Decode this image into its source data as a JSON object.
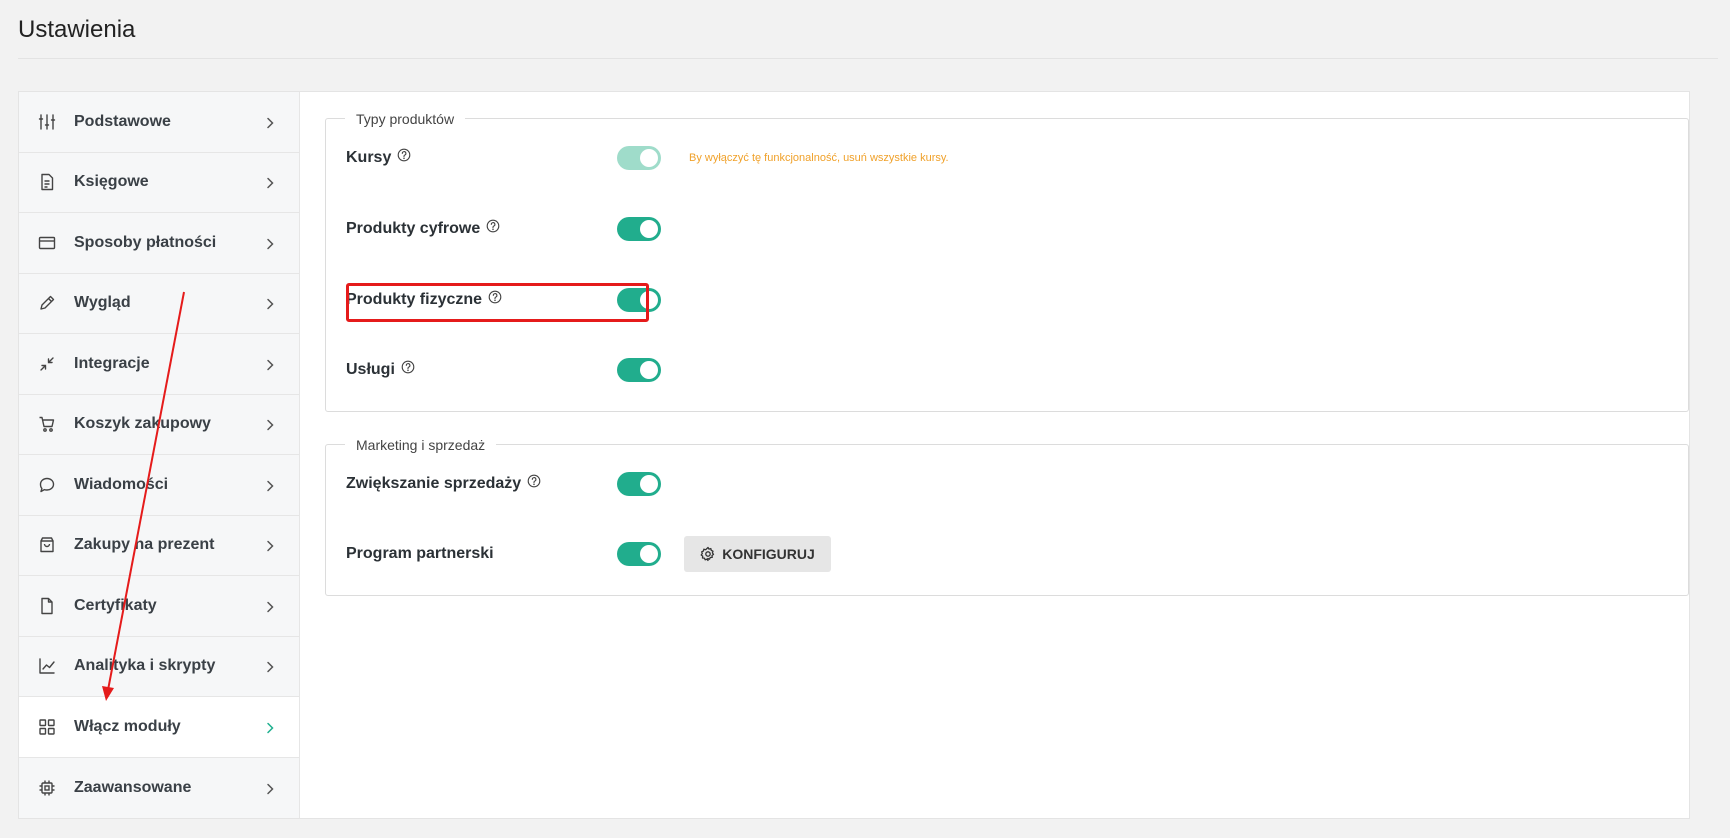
{
  "page": {
    "title": "Ustawienia"
  },
  "sidebar": {
    "items": [
      {
        "label": "Podstawowe",
        "icon": "sliders-icon"
      },
      {
        "label": "Księgowe",
        "icon": "document-icon"
      },
      {
        "label": "Sposoby płatności",
        "icon": "credit-card-icon"
      },
      {
        "label": "Wygląd",
        "icon": "pencil-icon"
      },
      {
        "label": "Integracje",
        "icon": "collapse-arrows-icon"
      },
      {
        "label": "Koszyk zakupowy",
        "icon": "cart-icon"
      },
      {
        "label": "Wiadomości",
        "icon": "chat-bubble-icon"
      },
      {
        "label": "Zakupy na prezent",
        "icon": "gift-bag-icon"
      },
      {
        "label": "Certyfikaty",
        "icon": "file-icon"
      },
      {
        "label": "Analityka i skrypty",
        "icon": "line-chart-icon"
      },
      {
        "label": "Włącz moduły",
        "icon": "grid-icon",
        "active": true
      },
      {
        "label": "Zaawansowane",
        "icon": "cpu-chip-icon"
      }
    ]
  },
  "sections": {
    "product_types": {
      "legend": "Typy produktów",
      "rows": [
        {
          "label": "Kursy",
          "enabled": true,
          "disabled": true,
          "note": "By wyłączyć tę funkcjonalność, usuń wszystkie kursy."
        },
        {
          "label": "Produkty cyfrowe",
          "enabled": true
        },
        {
          "label": "Produkty fizyczne",
          "enabled": true
        },
        {
          "label": "Usługi",
          "enabled": true
        }
      ]
    },
    "marketing": {
      "legend": "Marketing i sprzedaż",
      "rows": [
        {
          "label": "Zwiększanie sprzedaży",
          "enabled": true
        },
        {
          "label": "Program partnerski",
          "enabled": true,
          "button_label": "KONFIGURUJ"
        }
      ]
    }
  },
  "colors": {
    "accent": "#21ad8d",
    "accent_disabled": "#9fdcca",
    "warning": "#f0a12a",
    "annotation": "#e51b1b"
  }
}
